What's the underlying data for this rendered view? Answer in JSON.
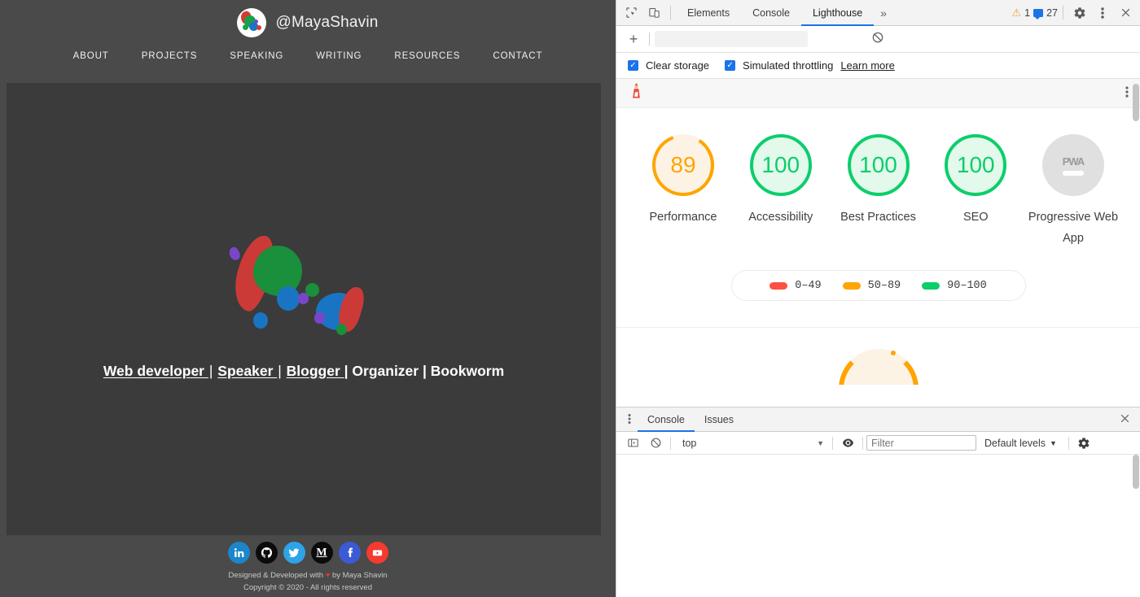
{
  "site": {
    "brand": {
      "handle": "@MayaShavin",
      "avatar_icon": "maya-avatar-logo"
    },
    "nav": [
      {
        "label": "ABOUT"
      },
      {
        "label": "PROJECTS"
      },
      {
        "label": "SPEAKING"
      },
      {
        "label": "WRITING"
      },
      {
        "label": "RESOURCES"
      },
      {
        "label": "CONTACT"
      }
    ],
    "hero": {
      "logo_icon": "colorful-splash-logo",
      "tagline_parts": [
        {
          "text": "Web developer ",
          "underline": true
        },
        {
          "text": "| ",
          "underline": false
        },
        {
          "text": "Speaker ",
          "underline": true
        },
        {
          "text": "| ",
          "underline": false
        },
        {
          "text": "Blogger ",
          "underline": true
        },
        {
          "text": "| Organizer | Bookworm",
          "underline": false
        }
      ],
      "tagline_plain": "Web developer | Speaker | Blogger | Organizer | Bookworm"
    },
    "footer": {
      "socials": [
        {
          "name": "linkedin",
          "label": "in",
          "color": "#1b86c9"
        },
        {
          "name": "github",
          "label": "gh",
          "color": "#0b0b0b"
        },
        {
          "name": "twitter",
          "label": "tw",
          "color": "#2fa3e8"
        },
        {
          "name": "medium",
          "label": "M",
          "color": "#0b0b0b"
        },
        {
          "name": "facebook",
          "label": "f",
          "color": "#3b5bd6"
        },
        {
          "name": "youtube",
          "label": "yt",
          "color": "#f63a30"
        }
      ],
      "credit_prefix": "Designed & Developed with ",
      "credit_heart": "♥",
      "credit_suffix": " by Maya Shavin",
      "copyright": "Copyright © 2020 - All rights reserved"
    }
  },
  "devtools": {
    "toolbar": {
      "inspect_icon": "inspect-element-icon",
      "device_icon": "device-toolbar-icon",
      "tabs": [
        {
          "label": "Elements",
          "active": false
        },
        {
          "label": "Console",
          "active": false
        },
        {
          "label": "Lighthouse",
          "active": true
        }
      ],
      "more_tabs": "»",
      "warning_count": "1",
      "message_count": "27",
      "settings_icon": "gear-icon",
      "kebab_icon": "more-options-icon",
      "close_icon": "close-icon"
    },
    "lighthouse": {
      "add_icon": "add-icon",
      "clear_icon": "clear-results-icon",
      "options": [
        {
          "label": "Clear storage",
          "checked": true
        },
        {
          "label": "Simulated throttling",
          "checked": true
        }
      ],
      "learn_more": "Learn more",
      "report_logo_icon": "lighthouse-logo-icon",
      "report_menu_icon": "report-options-icon",
      "legend": [
        {
          "range": "0–49",
          "color": "#ff4e42"
        },
        {
          "range": "50–89",
          "color": "#ffa400"
        },
        {
          "range": "90–100",
          "color": "#0cce6b"
        }
      ]
    },
    "drawer": {
      "kebab_icon": "drawer-options-icon",
      "tabs": [
        {
          "label": "Console",
          "active": true
        },
        {
          "label": "Issues",
          "active": false
        }
      ],
      "close_icon": "close-drawer-icon",
      "sidebar_icon": "console-sidebar-icon",
      "clear_icon": "clear-console-icon",
      "context": "top",
      "eye_icon": "live-expression-icon",
      "filter_placeholder": "Filter",
      "filter_value": "",
      "levels": "Default levels",
      "settings_icon": "console-settings-icon"
    }
  },
  "chart_data": {
    "type": "bar",
    "title": "Lighthouse category scores",
    "categories": [
      "Performance",
      "Accessibility",
      "Best Practices",
      "SEO",
      "Progressive Web App"
    ],
    "values": [
      89,
      100,
      100,
      100,
      null
    ],
    "value_labels": [
      "89",
      "100",
      "100",
      "100",
      "PWA"
    ],
    "colors": [
      "#ffa400",
      "#0cce6b",
      "#0cce6b",
      "#0cce6b",
      "#e0e0e0"
    ],
    "ylim": [
      0,
      100
    ],
    "legend": [
      "0–49",
      "50–89",
      "90–100"
    ],
    "legend_position": "bottom",
    "grid": false
  }
}
